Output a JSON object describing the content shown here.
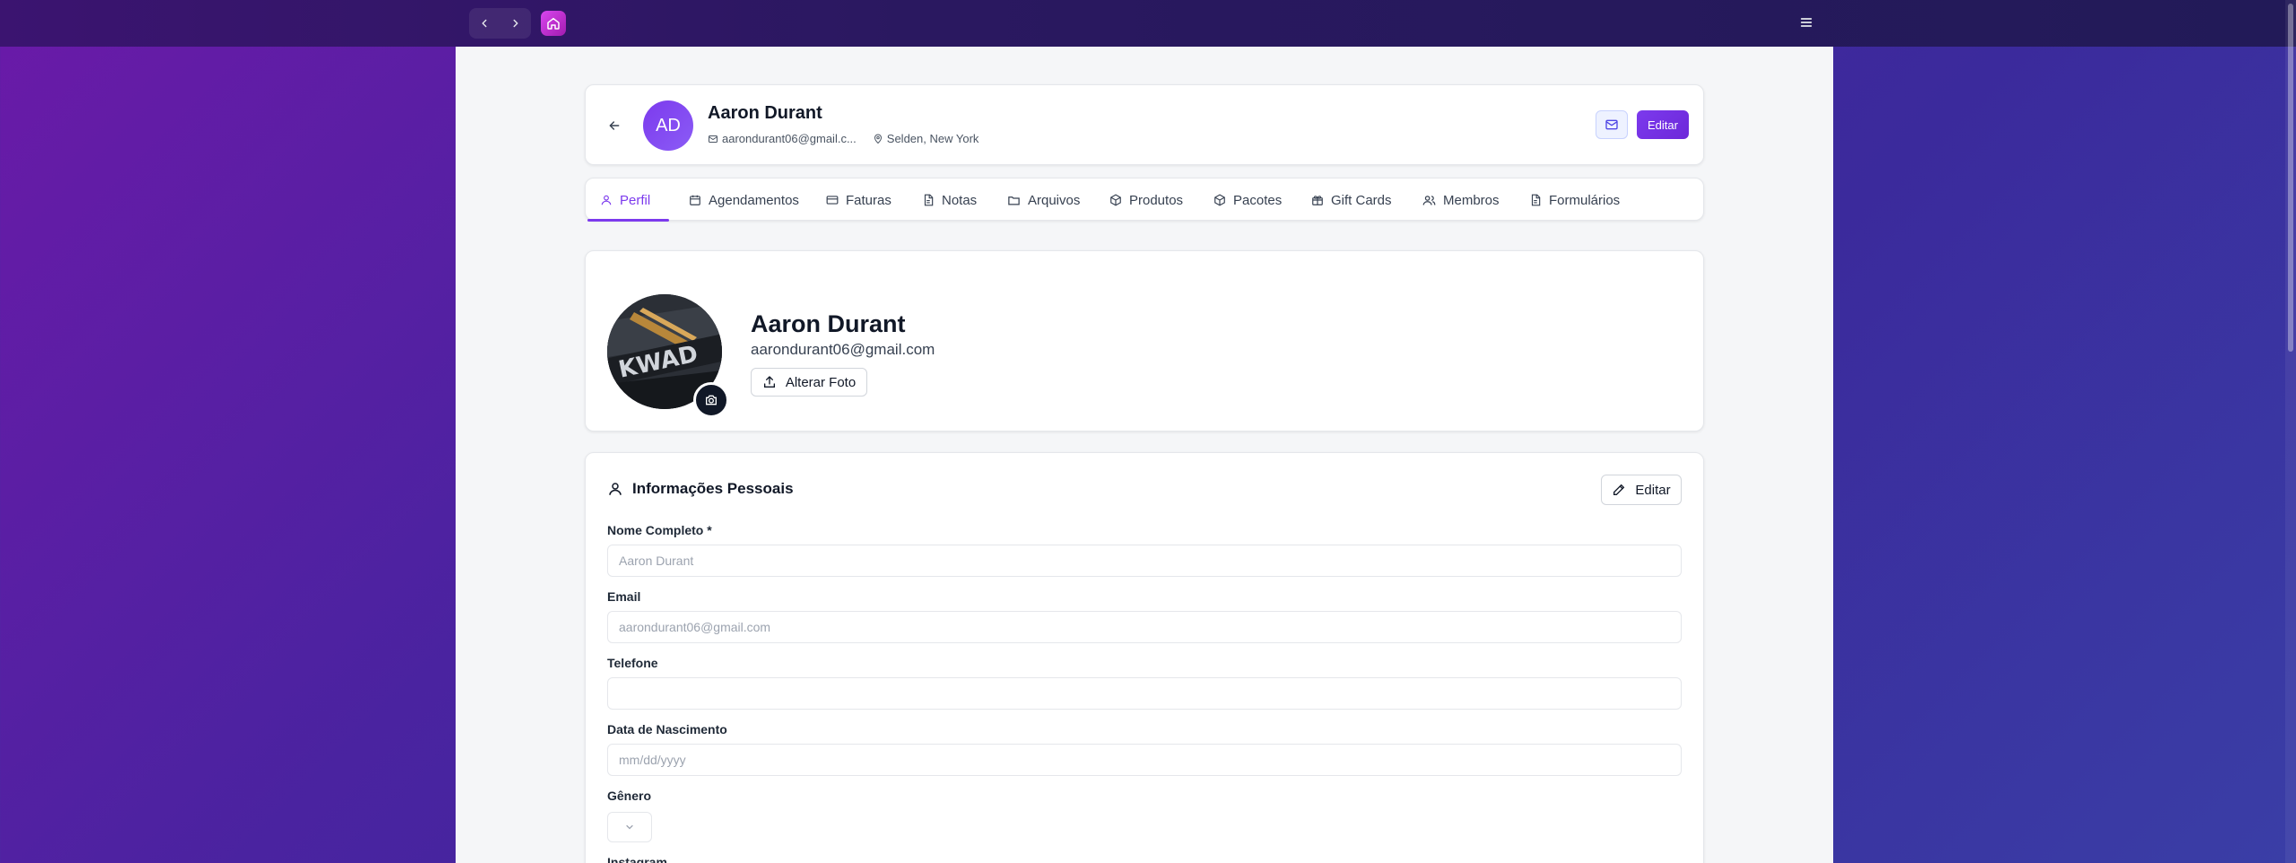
{
  "topbar": {
    "icons": [
      "chevron-left-icon",
      "chevron-right-icon",
      "home-icon",
      "hamburger-menu-icon"
    ]
  },
  "client": {
    "initials": "AD",
    "name": "Aaron Durant",
    "email_short": "aarondurant06@gmail.c...",
    "location": "Selden, New York",
    "edit_label": "Editar"
  },
  "tabs": [
    {
      "label": "Perfil",
      "icon": "user-icon",
      "active": true
    },
    {
      "label": "Agendamentos",
      "icon": "calendar-icon"
    },
    {
      "label": "Faturas",
      "icon": "credit-card-icon"
    },
    {
      "label": "Notas",
      "icon": "document-icon"
    },
    {
      "label": "Arquivos",
      "icon": "folder-icon"
    },
    {
      "label": "Produtos",
      "icon": "package-icon"
    },
    {
      "label": "Pacotes",
      "icon": "package-icon"
    },
    {
      "label": "Gift Cards",
      "icon": "gift-icon"
    },
    {
      "label": "Membros",
      "icon": "users-icon"
    },
    {
      "label": "Formulários",
      "icon": "document-icon"
    }
  ],
  "photo_card": {
    "name": "Aaron Durant",
    "email": "aarondurant06@gmail.com",
    "change_photo_label": "Alterar Foto",
    "photo_text": "KWAD"
  },
  "personal_info": {
    "title": "Informações Pessoais",
    "edit_label": "Editar",
    "fields": {
      "full_name": {
        "label": "Nome Completo *",
        "value": "Aaron Durant"
      },
      "email": {
        "label": "Email",
        "value": "aarondurant06@gmail.com"
      },
      "phone": {
        "label": "Telefone",
        "value": ""
      },
      "birthdate": {
        "label": "Data de Nascimento",
        "placeholder": "mm/dd/yyyy"
      },
      "gender": {
        "label": "Gênero",
        "value": ""
      },
      "instagram": {
        "label": "Instagram"
      }
    }
  },
  "colors": {
    "accent": "#7c3aed",
    "home_button": "#c026d3",
    "background_gradient_start": "#6a1aa8",
    "background_gradient_end": "#3a3ea6"
  }
}
